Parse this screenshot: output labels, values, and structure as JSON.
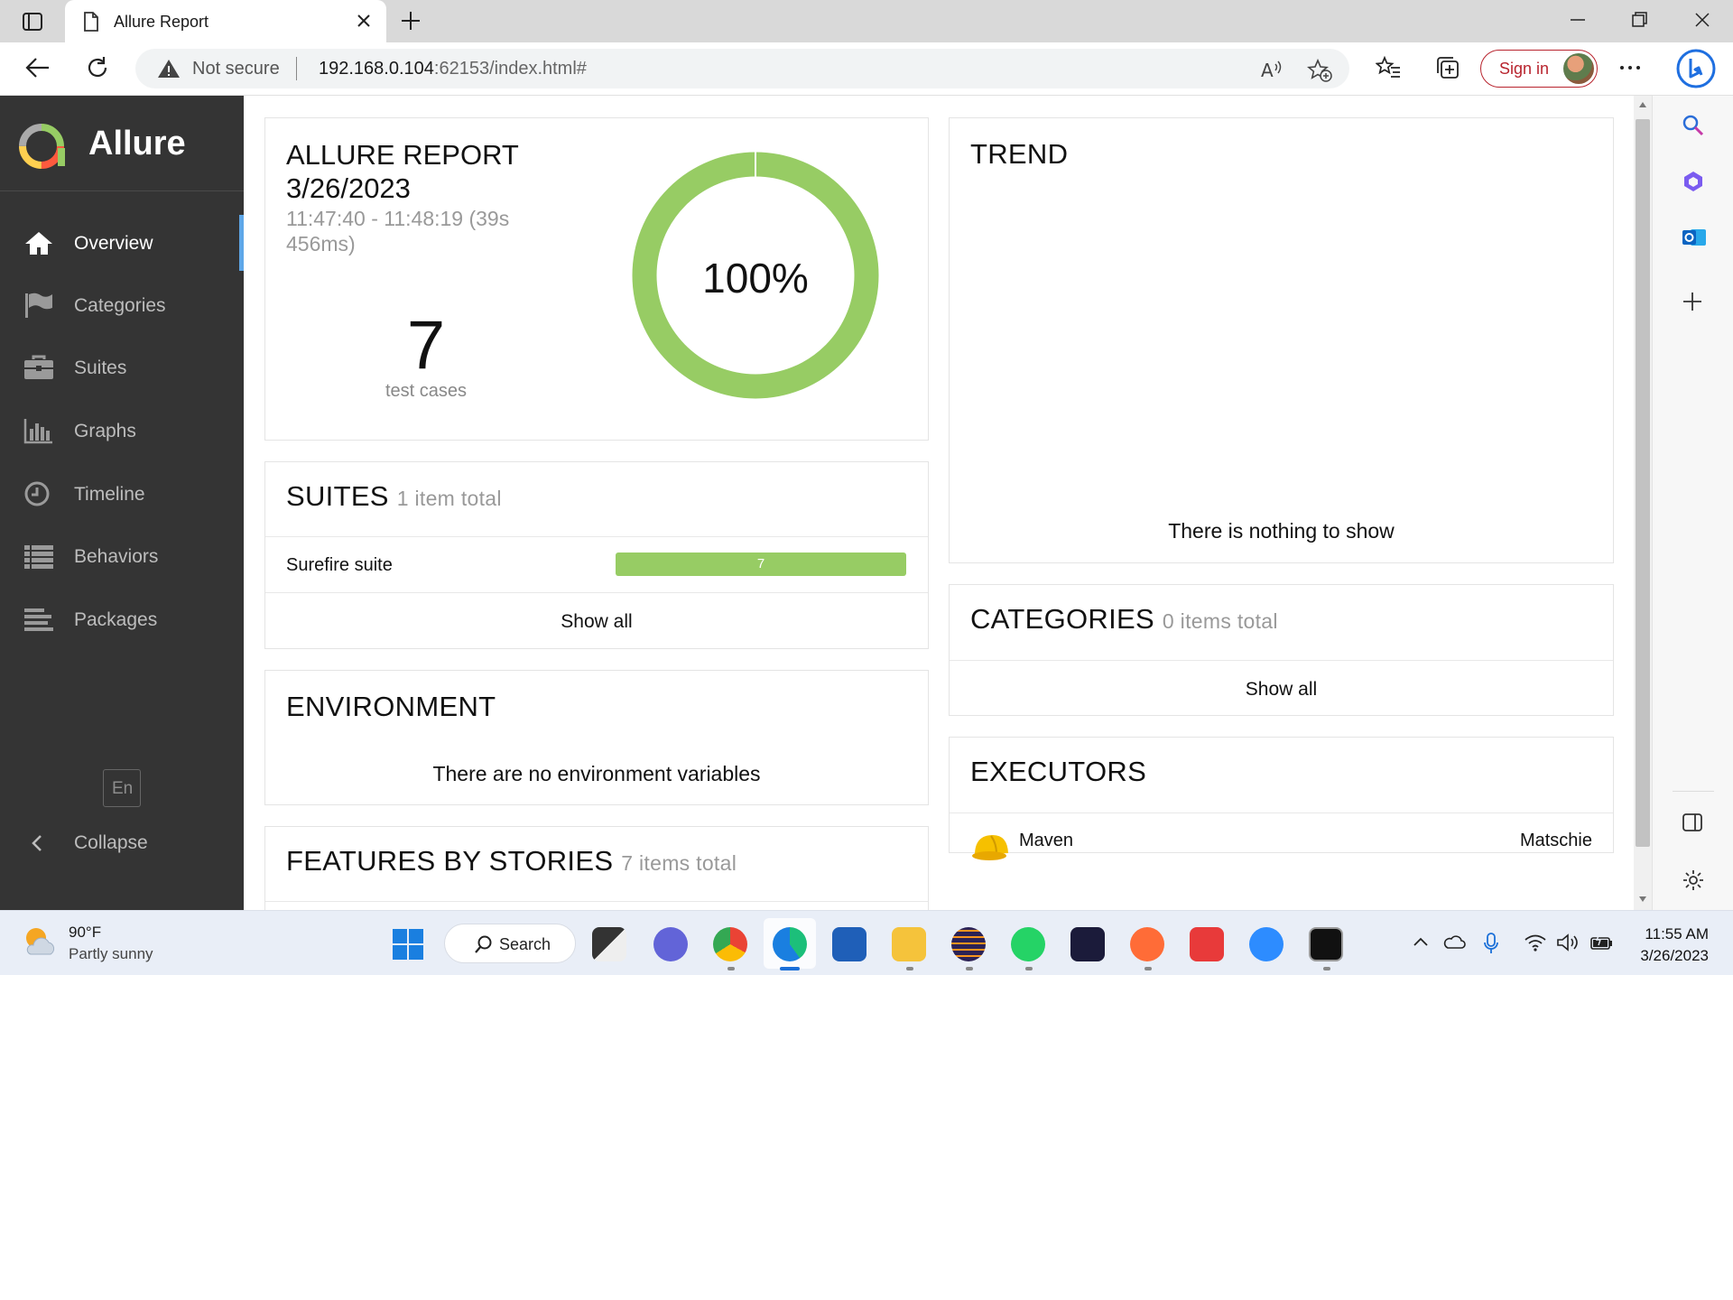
{
  "browser": {
    "tab_title": "Allure Report",
    "security_label": "Not secure",
    "url_host": "192.168.0.104",
    "url_rest": ":62153/index.html#",
    "signin_label": "Sign in",
    "accent": "#b8242e"
  },
  "sidebar": {
    "brand": "Allure",
    "items": [
      {
        "label": "Overview",
        "icon": "home-icon",
        "active": true
      },
      {
        "label": "Categories",
        "icon": "flag-icon"
      },
      {
        "label": "Suites",
        "icon": "briefcase-icon"
      },
      {
        "label": "Graphs",
        "icon": "bar-chart-icon"
      },
      {
        "label": "Timeline",
        "icon": "clock-icon"
      },
      {
        "label": "Behaviors",
        "icon": "list-icon"
      },
      {
        "label": "Packages",
        "icon": "align-left-icon"
      }
    ],
    "language": "En",
    "collapse_label": "Collapse",
    "active_color": "#5ea7e8",
    "bg_color": "#343434"
  },
  "summary": {
    "title": "ALLURE REPORT",
    "date": "3/26/2023",
    "time_range": "11:47:40 - 11:48:19 (39s 456ms)",
    "test_count": "7",
    "test_count_label": "test cases",
    "pass_rate_label": "100%",
    "pass_rate": 1.0,
    "pass_color": "#97cc64"
  },
  "trend": {
    "title": "TREND",
    "empty": "There is nothing to show"
  },
  "suites": {
    "title": "SUITES",
    "subtitle": "1 item total",
    "rows": [
      {
        "name": "Surefire suite",
        "passed": "7"
      }
    ],
    "show_all": "Show all"
  },
  "categories": {
    "title": "CATEGORIES",
    "subtitle": "0 items total",
    "show_all": "Show all"
  },
  "environment": {
    "title": "ENVIRONMENT",
    "empty": "There are no environment variables"
  },
  "executors": {
    "title": "EXECUTORS",
    "rows": [
      {
        "name": "Maven",
        "build": "Matschie",
        "icon": "hard-hat-icon"
      }
    ]
  },
  "features": {
    "title": "FEATURES BY STORIES",
    "subtitle": "7 items total"
  },
  "taskbar": {
    "temperature": "90°F",
    "condition": "Partly sunny",
    "search_label": "Search",
    "time": "11:55 AM",
    "date": "3/26/2023"
  }
}
